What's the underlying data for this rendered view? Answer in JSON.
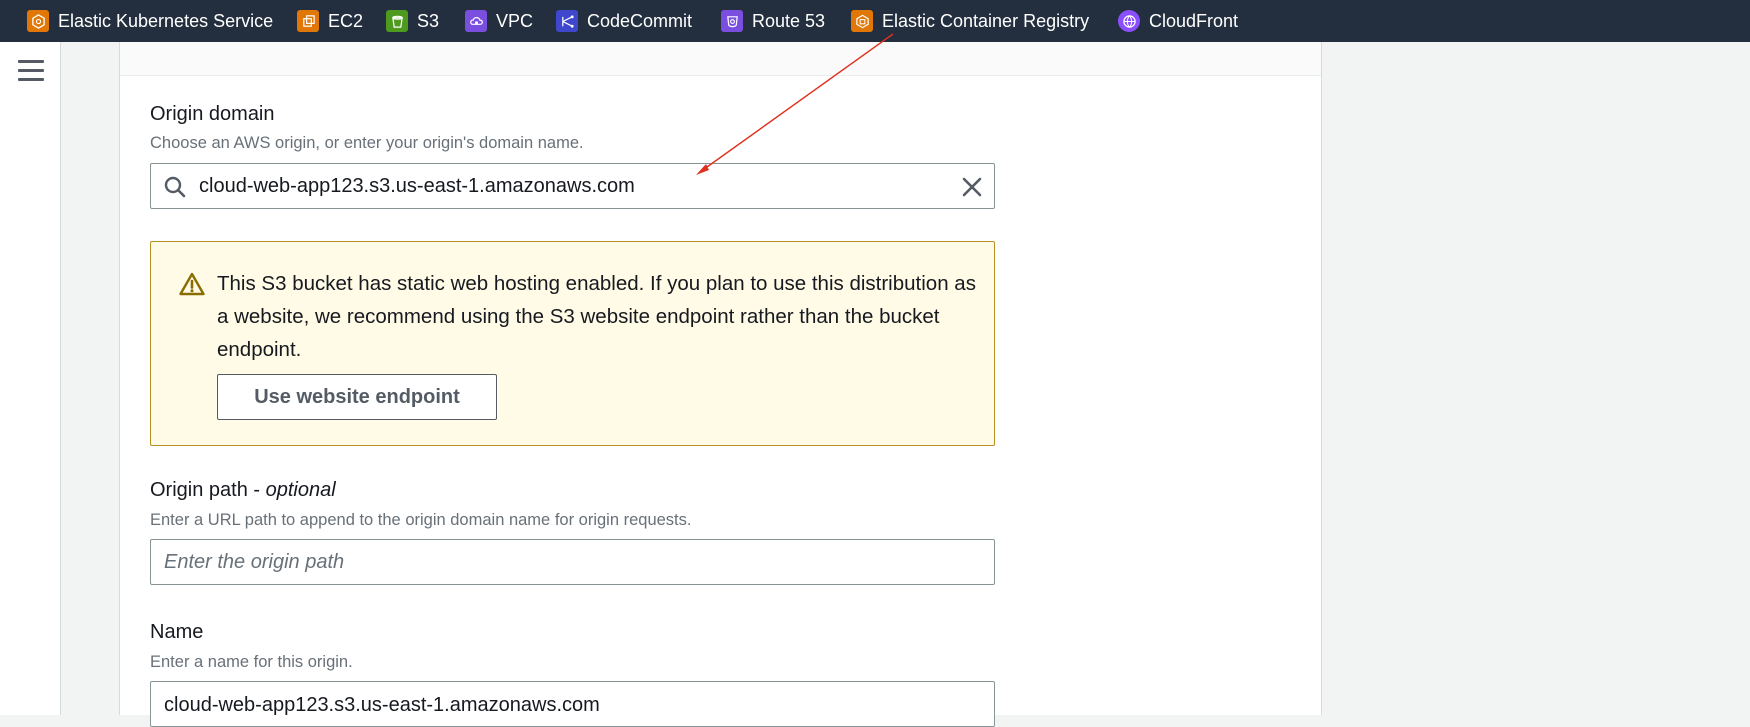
{
  "favorites_bar": {
    "items": [
      {
        "label": "Elastic Kubernetes Service",
        "icon": "eks-icon",
        "color": "#e07707"
      },
      {
        "label": "EC2",
        "icon": "ec2-icon",
        "color": "#e07707"
      },
      {
        "label": "S3",
        "icon": "s3-icon",
        "color": "#4d9a1f"
      },
      {
        "label": "VPC",
        "icon": "vpc-icon",
        "color": "#7a4fe0"
      },
      {
        "label": "CodeCommit",
        "icon": "codecommit-icon",
        "color": "#3f48cc"
      },
      {
        "label": "Route 53",
        "icon": "route53-icon",
        "color": "#7a4fe0"
      },
      {
        "label": "Elastic Container Registry",
        "icon": "ecr-icon",
        "color": "#e07707"
      },
      {
        "label": "CloudFront",
        "icon": "cloudfront-icon",
        "color": "#8c4fff"
      }
    ]
  },
  "nav": {
    "menu_icon": "hamburger-menu-icon"
  },
  "origin_domain": {
    "label": "Origin domain",
    "description": "Choose an AWS origin, or enter your origin's domain name.",
    "value": "cloud-web-app123.s3.us-east-1.amazonaws.com"
  },
  "warning": {
    "text": "This S3 bucket has static web hosting enabled. If you plan to use this distribution as a website, we recommend using the S3 website endpoint rather than the bucket endpoint.",
    "button_label": "Use website endpoint",
    "bg_color": "#fffbe6",
    "border_color": "#b88f22"
  },
  "origin_path": {
    "label": "Origin path",
    "label_separator": " - ",
    "label_optional": "optional",
    "description": "Enter a URL path to append to the origin domain name for origin requests.",
    "placeholder": "Enter the origin path"
  },
  "name": {
    "label": "Name",
    "description": "Enter a name for this origin.",
    "value": "cloud-web-app123.s3.us-east-1.amazonaws.com"
  },
  "annotation": {
    "arrow_color": "#e0301e"
  }
}
